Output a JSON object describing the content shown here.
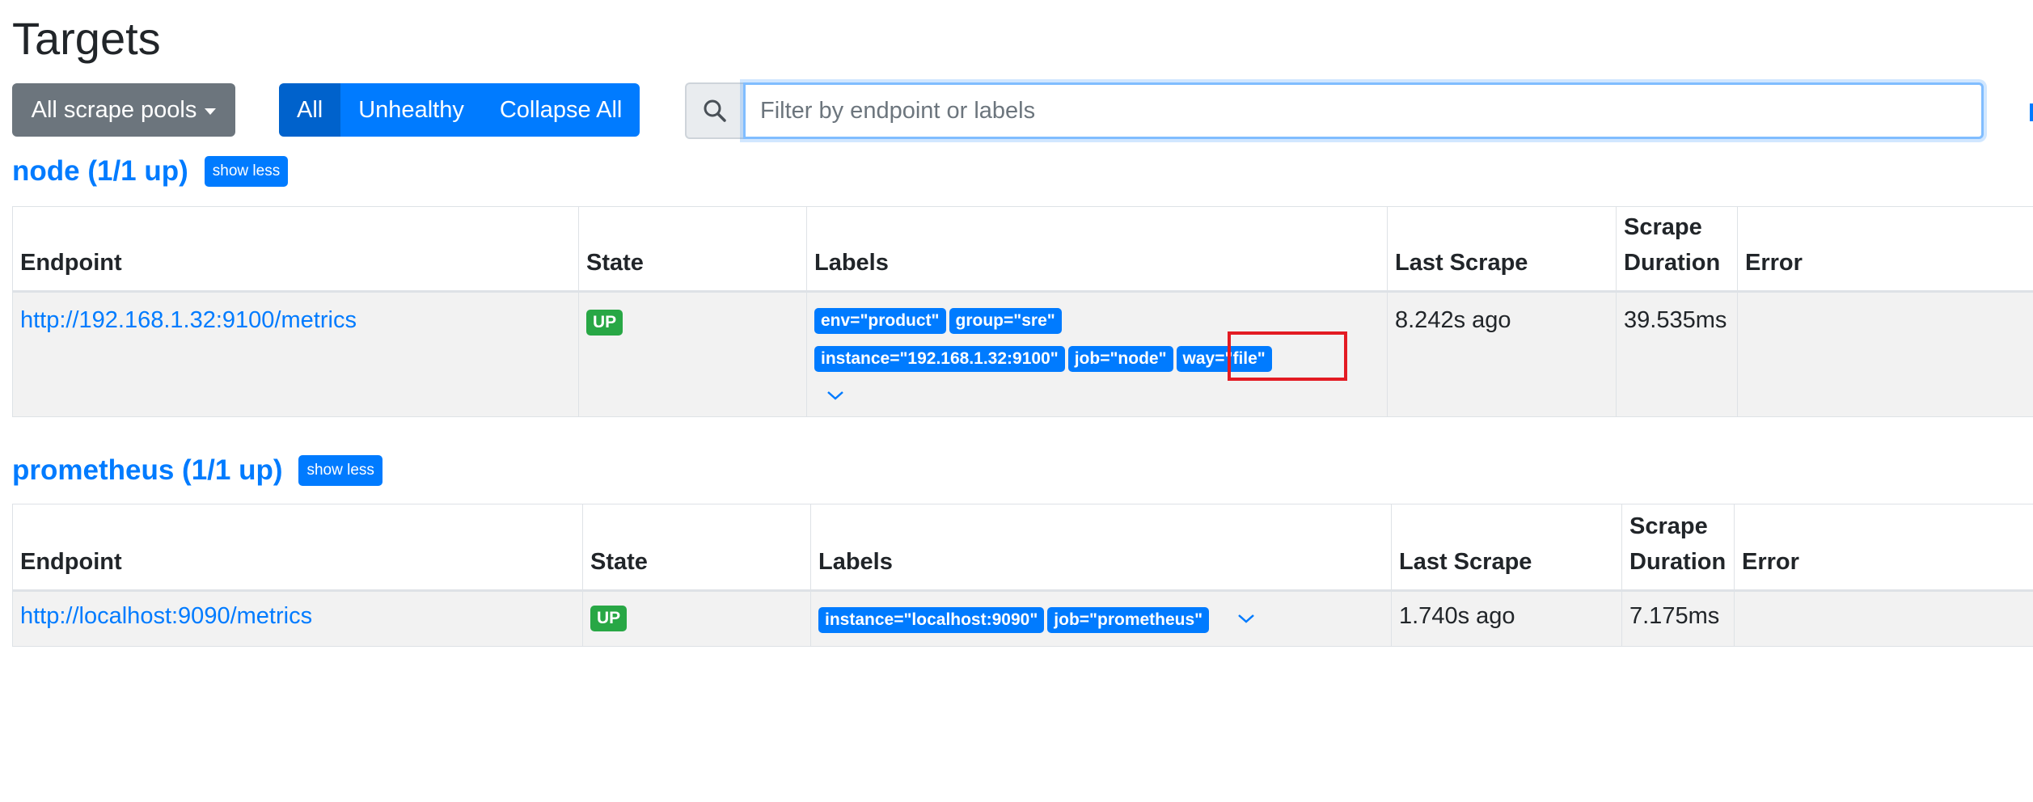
{
  "page": {
    "title": "Targets"
  },
  "toolbar": {
    "pool_select_label": "All scrape pools",
    "filter_buttons": {
      "all": "All",
      "unhealthy": "Unhealthy",
      "collapse": "Collapse All"
    },
    "search_placeholder": "Filter by endpoint or labels"
  },
  "columns": {
    "endpoint": "Endpoint",
    "state": "State",
    "labels": "Labels",
    "last_scrape": "Last Scrape",
    "scrape_duration_1": "Scrape",
    "scrape_duration_2": "Duration",
    "error": "Error"
  },
  "pools": [
    {
      "title": "node (1/1 up)",
      "toggle_label": "show less",
      "target": {
        "endpoint": "http://192.168.1.32:9100/metrics",
        "state": "UP",
        "labels": [
          "env=\"product\"",
          "group=\"sre\"",
          "instance=\"192.168.1.32:9100\"",
          "job=\"node\"",
          "way=\"file\""
        ],
        "last_scrape": "8.242s ago",
        "scrape_duration": "39.535ms",
        "error": ""
      }
    },
    {
      "title": "prometheus (1/1 up)",
      "toggle_label": "show less",
      "target": {
        "endpoint": "http://localhost:9090/metrics",
        "state": "UP",
        "labels": [
          "instance=\"localhost:9090\"",
          "job=\"prometheus\""
        ],
        "last_scrape": "1.740s ago",
        "scrape_duration": "7.175ms",
        "error": ""
      }
    }
  ],
  "icons": {
    "search": "search-icon",
    "expand": "chevron-down-icon",
    "dropdown": "caret-down-icon"
  },
  "colors": {
    "primary": "#007bff",
    "success": "#28a745",
    "secondary": "#6c757d",
    "highlight": "#e31b23"
  }
}
